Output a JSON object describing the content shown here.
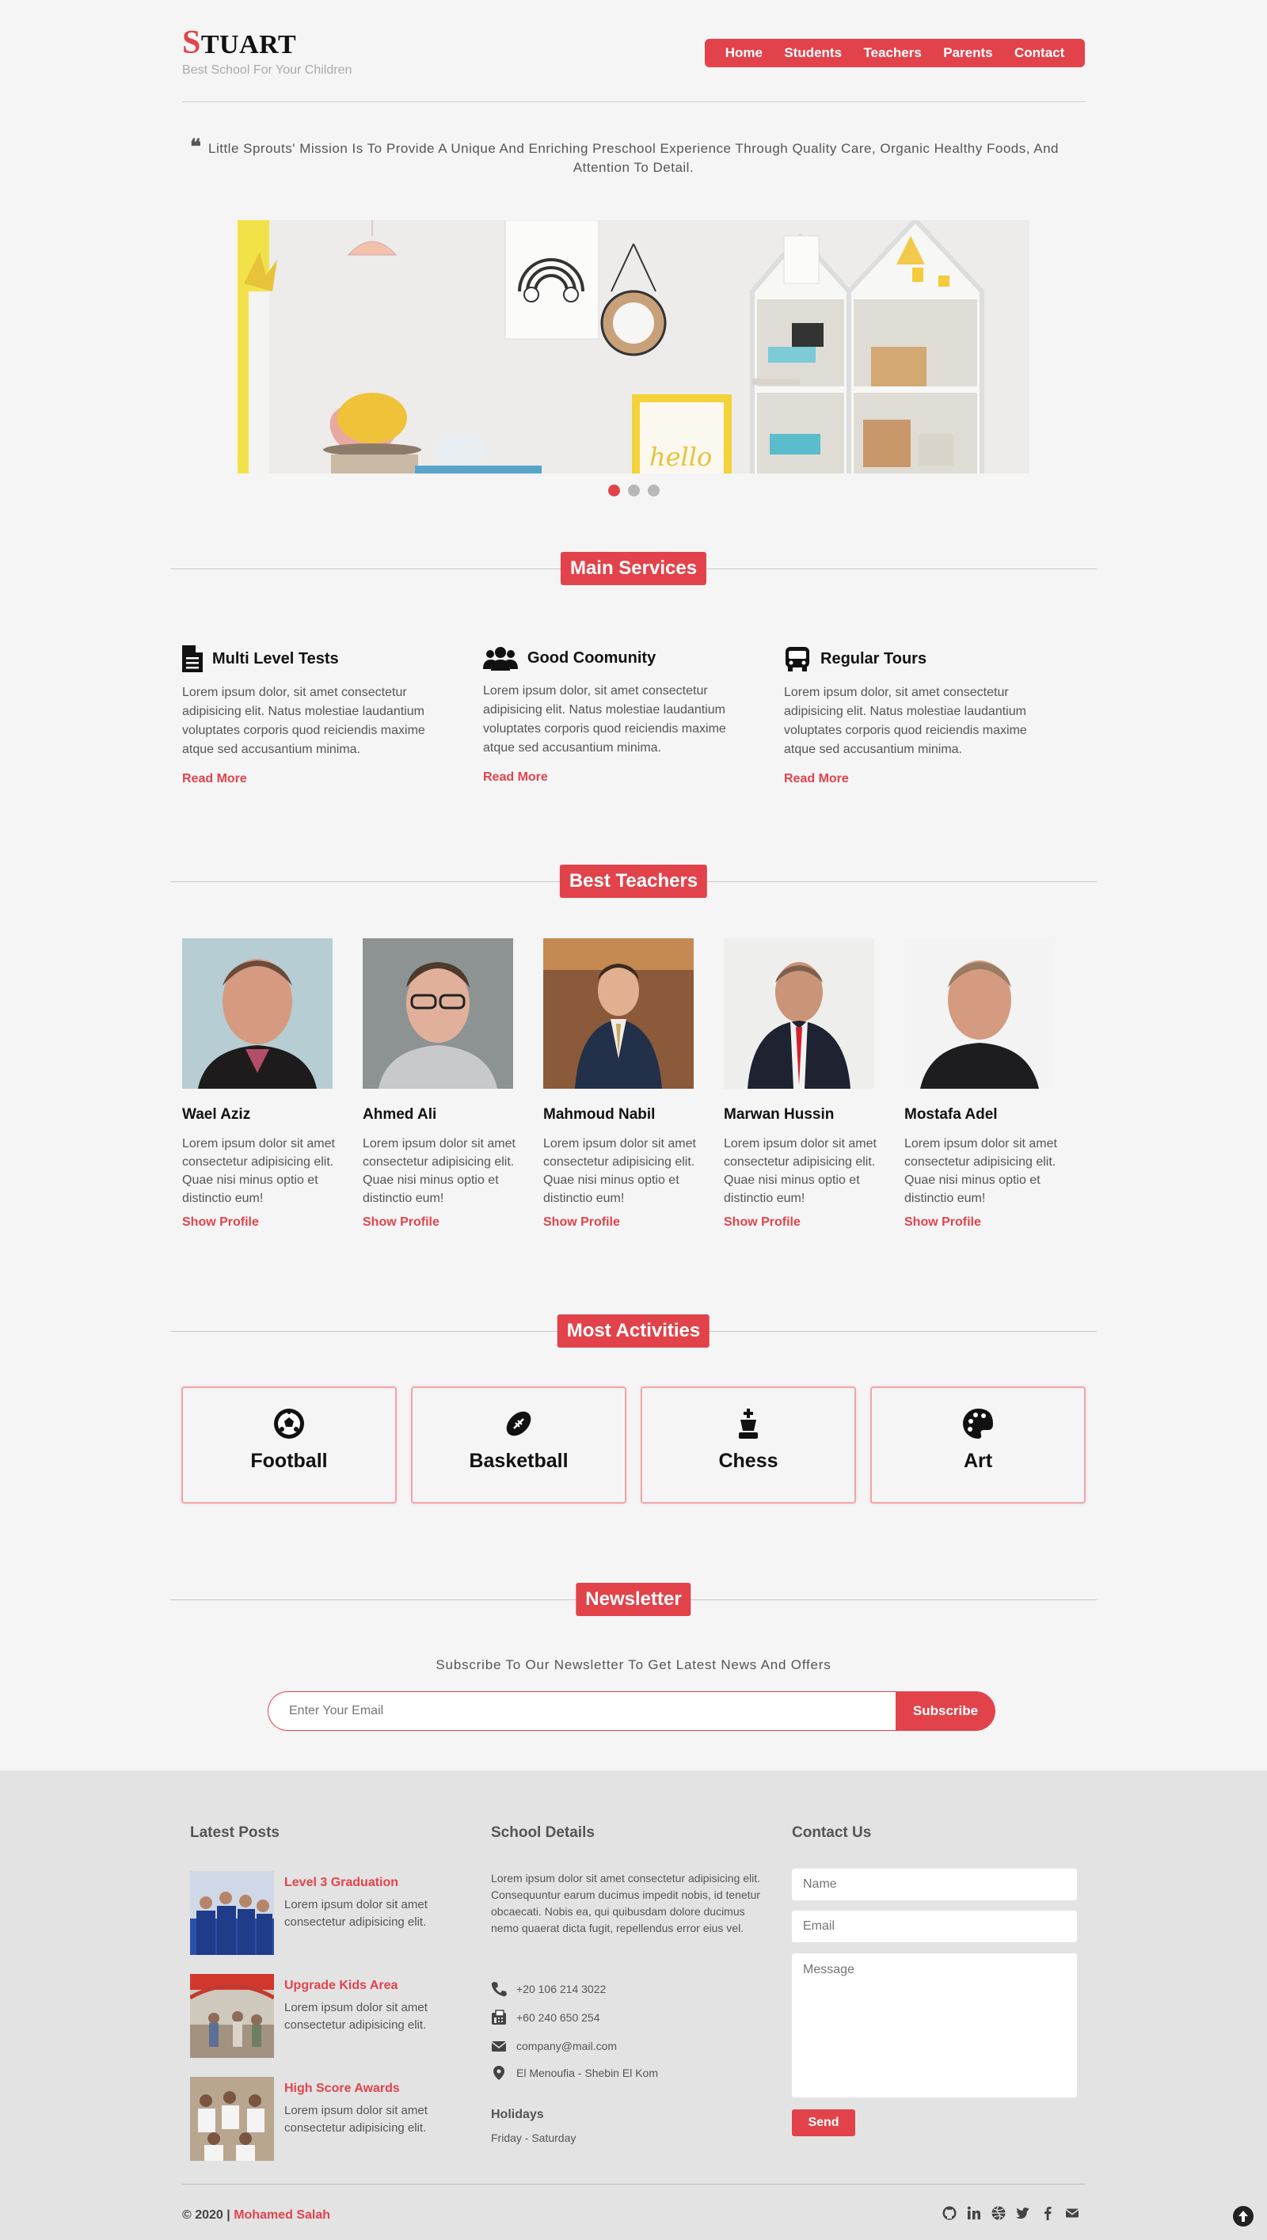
{
  "header": {
    "logo_first": "S",
    "logo_rest": "TUART",
    "tagline": "Best School For Your Children",
    "nav": [
      "Home",
      "Students",
      "Teachers",
      "Parents",
      "Contact"
    ]
  },
  "quote": "Little Sprouts' Mission Is To Provide A Unique And Enriching Preschool Experience Through Quality Care, Organic Healthy Foods, And Attention To Detail.",
  "slider": {
    "slides": 3,
    "active": 1
  },
  "services": {
    "title": "Main Services",
    "items": [
      {
        "icon": "document-icon",
        "title": "Multi Level Tests",
        "text": "Lorem ipsum dolor, sit amet consectetur adipisicing elit. Natus molestiae laudantium voluptates corporis quod reiciendis maxime atque sed accusantium minima.",
        "link": "Read More"
      },
      {
        "icon": "users-icon",
        "title": "Good Coomunity",
        "text": "Lorem ipsum dolor, sit amet consectetur adipisicing elit. Natus molestiae laudantium voluptates corporis quod reiciendis maxime atque sed accusantium minima.",
        "link": "Read More"
      },
      {
        "icon": "bus-icon",
        "title": "Regular Tours",
        "text": "Lorem ipsum dolor, sit amet consectetur adipisicing elit. Natus molestiae laudantium voluptates corporis quod reiciendis maxime atque sed accusantium minima.",
        "link": "Read More"
      }
    ]
  },
  "teachers": {
    "title": "Best Teachers",
    "items": [
      {
        "name": "Wael Aziz",
        "text": "Lorem ipsum dolor sit amet consectetur adipisicing elit. Quae nisi minus optio et distinctio eum!",
        "link": "Show Profile"
      },
      {
        "name": "Ahmed Ali",
        "text": "Lorem ipsum dolor sit amet consectetur adipisicing elit. Quae nisi minus optio et distinctio eum!",
        "link": "Show Profile"
      },
      {
        "name": "Mahmoud Nabil",
        "text": "Lorem ipsum dolor sit amet consectetur adipisicing elit. Quae nisi minus optio et distinctio eum!",
        "link": "Show Profile"
      },
      {
        "name": "Marwan Hussin",
        "text": "Lorem ipsum dolor sit amet consectetur adipisicing elit. Quae nisi minus optio et distinctio eum!",
        "link": "Show Profile"
      },
      {
        "name": "Mostafa Adel",
        "text": "Lorem ipsum dolor sit amet consectetur adipisicing elit. Quae nisi minus optio et distinctio eum!",
        "link": "Show Profile"
      }
    ]
  },
  "activities": {
    "title": "Most Activities",
    "items": [
      {
        "icon": "football-icon",
        "label": "Football"
      },
      {
        "icon": "basketball-icon",
        "label": "Basketball"
      },
      {
        "icon": "chess-icon",
        "label": "Chess"
      },
      {
        "icon": "palette-icon",
        "label": "Art"
      }
    ]
  },
  "newsletter": {
    "title": "Newsletter",
    "text": "Subscribe To Our Newsletter To Get Latest News And Offers",
    "placeholder": "Enter Your Email",
    "button": "Subscribe"
  },
  "footer": {
    "posts_title": "Latest Posts",
    "posts": [
      {
        "title": "Level 3 Graduation",
        "text": "Lorem ipsum dolor sit amet consectetur adipisicing elit."
      },
      {
        "title": "Upgrade Kids Area",
        "text": "Lorem ipsum dolor sit amet consectetur adipisicing elit."
      },
      {
        "title": "High Score Awards",
        "text": "Lorem ipsum dolor sit amet consectetur adipisicing elit."
      }
    ],
    "school_title": "School Details",
    "school_text": "Lorem ipsum dolor sit amet consectetur adipisicing elit. Consequuntur earum ducimus impedit nobis, id tenetur obcaecati. Nobis ea, qui quibusdam dolore ducimus nemo quaerat dicta fugit, repellendus error eius vel.",
    "phone": "+20 106 214 3022",
    "fax": "+60 240 650 254",
    "email": "company@mail.com",
    "address": "El Menoufia - Shebin El Kom",
    "holidays_title": "Holidays",
    "holidays": "Friday - Saturday",
    "contact_title": "Contact Us",
    "name_placeholder": "Name",
    "email_placeholder": "Email",
    "message_placeholder": "Message",
    "send": "Send",
    "copyright": "© 2020 |",
    "author": "Mohamed Salah",
    "socials": [
      "github-icon",
      "linkedin-icon",
      "globe-icon",
      "twitter-icon",
      "facebook-icon",
      "envelope-icon"
    ]
  },
  "colors": {
    "accent": "#e2434b",
    "background": "#f5f5f6",
    "footer": "#e3e3e4"
  }
}
